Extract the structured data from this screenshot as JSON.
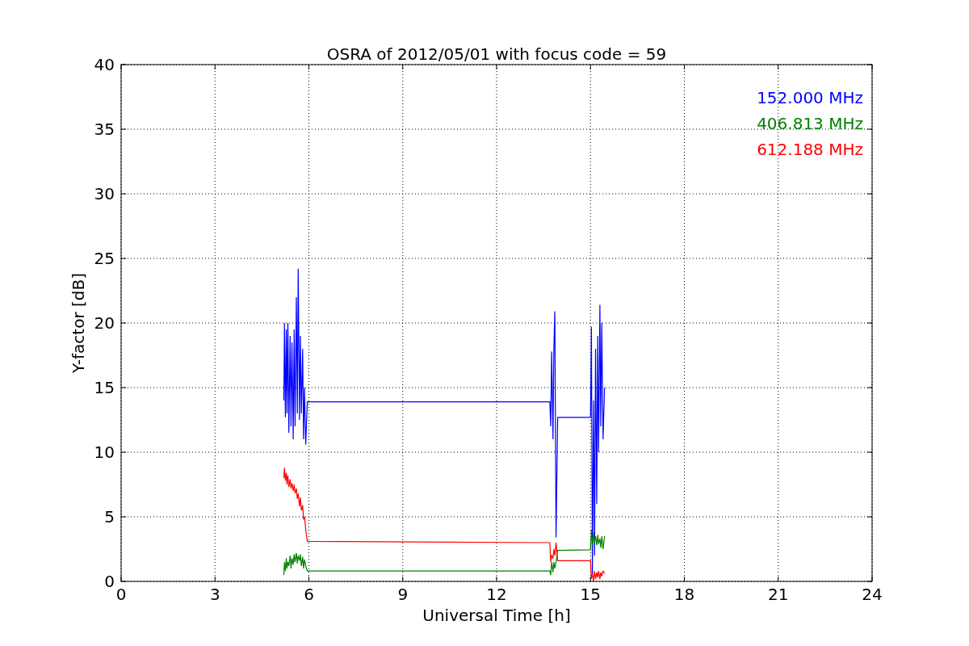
{
  "chart_data": {
    "type": "line",
    "title": "OSRA of 2012/05/01 with focus code = 59",
    "xlabel": "Universal Time [h]",
    "ylabel": "Y-factor [dB]",
    "x": [
      5.2,
      5.22,
      5.25,
      5.28,
      5.3,
      5.33,
      5.36,
      5.4,
      5.43,
      5.46,
      5.5,
      5.53,
      5.56,
      5.6,
      5.63,
      5.66,
      5.7,
      5.73,
      5.76,
      5.8,
      5.83,
      5.86,
      5.9,
      5.95,
      13.7,
      13.73,
      13.76,
      13.8,
      13.83,
      13.86,
      13.9,
      13.95,
      15.0,
      15.03,
      15.06,
      15.1,
      15.13,
      15.16,
      15.2,
      15.23,
      15.26,
      15.3,
      15.33,
      15.36,
      15.4,
      15.45
    ],
    "series": [
      {
        "name": "152.000 MHz",
        "color": "#0000ff",
        "values": [
          14,
          20,
          12.7,
          19.5,
          13,
          20,
          11.5,
          19,
          12,
          18.5,
          11,
          19.5,
          12,
          22,
          13,
          24.2,
          12.5,
          19,
          13,
          18,
          11,
          15,
          10.6,
          13.9,
          13.9,
          12,
          17.8,
          11,
          18,
          20.9,
          3.4,
          12.7,
          12.7,
          19.7,
          0.5,
          14,
          2,
          18,
          6,
          19,
          10,
          21.4,
          12,
          20,
          11,
          15
        ]
      },
      {
        "name": "406.813 MHz",
        "color": "#008000",
        "values": [
          0.5,
          1.5,
          0.8,
          1.8,
          1,
          1.5,
          1.2,
          2,
          1,
          1.8,
          1.3,
          2.1,
          1.5,
          2.2,
          1.4,
          2,
          1.6,
          2.1,
          1.2,
          1.9,
          1,
          1.7,
          1.2,
          0.8,
          0.8,
          0.5,
          1.5,
          0.7,
          1.5,
          1,
          1.5,
          2.4,
          2.45,
          4,
          2.8,
          3.8,
          3,
          3.5,
          2.8,
          3.6,
          2.9,
          3.3,
          2.6,
          3.5,
          2.5,
          3.5
        ]
      },
      {
        "name": "612.188 MHz",
        "color": "#ff0000",
        "values": [
          8,
          8.8,
          7.8,
          8.4,
          7.5,
          8.2,
          7.3,
          7.9,
          7.2,
          7.6,
          7,
          7.5,
          6.8,
          7.2,
          6.4,
          6.8,
          5.8,
          6.5,
          5.5,
          5.9,
          4.8,
          5,
          4,
          3.1,
          3,
          1.5,
          2,
          1.8,
          2.5,
          2,
          3,
          1.6,
          1.6,
          0.2,
          0.6,
          0,
          0.8,
          0.2,
          0.7,
          0.3,
          0.8,
          0.2,
          0.7,
          0.4,
          0.8,
          0.6
        ]
      }
    ],
    "xlim": [
      0,
      24
    ],
    "ylim": [
      0,
      40
    ],
    "xticks": [
      0,
      3,
      6,
      9,
      12,
      15,
      18,
      21,
      24
    ],
    "yticks": [
      0,
      5,
      10,
      15,
      20,
      25,
      30,
      35,
      40
    ],
    "grid": true
  }
}
